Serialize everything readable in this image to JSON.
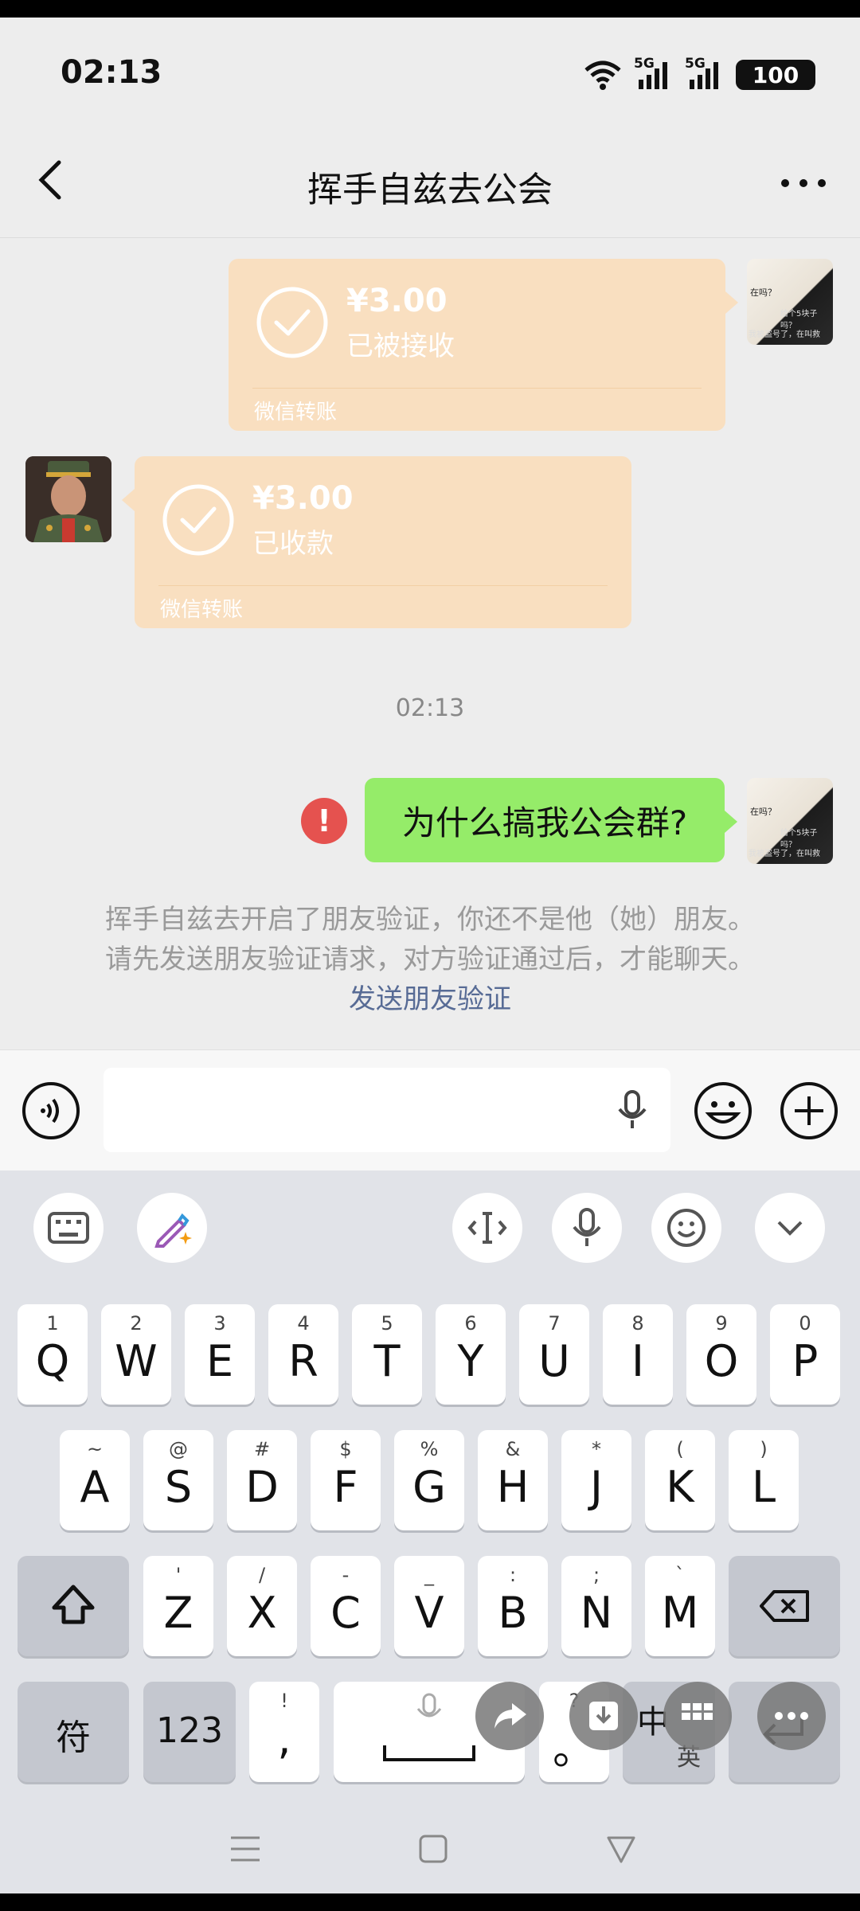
{
  "status_bar": {
    "time": "02:13",
    "signal1": "5G",
    "signal2": "5G",
    "battery": "100"
  },
  "header": {
    "title": "挥手自兹去公会"
  },
  "messages": {
    "transfer_sent": {
      "amount": "¥3.00",
      "status": "已被接收",
      "label": "微信转账"
    },
    "transfer_received": {
      "amount": "¥3.00",
      "status": "已收款",
      "label": "微信转账"
    },
    "timestamp": "02:13",
    "text_message": "为什么搞我公会群?",
    "error_mark": "!",
    "system_notice": {
      "line1": "挥手自兹去开启了朋友验证，你还不是他（她）朋友。",
      "line2": "请先发送朋友验证请求，对方验证通过后，才能聊天。",
      "link": "发送朋友验证"
    }
  },
  "avatar_me_text": {
    "t1": "在吗？",
    "t2": "给个5块子吗？",
    "t3": "我被盗号了，在叫救"
  },
  "keyboard": {
    "row1": [
      {
        "main": "Q",
        "sub": "1"
      },
      {
        "main": "W",
        "sub": "2"
      },
      {
        "main": "E",
        "sub": "3"
      },
      {
        "main": "R",
        "sub": "4"
      },
      {
        "main": "T",
        "sub": "5"
      },
      {
        "main": "Y",
        "sub": "6"
      },
      {
        "main": "U",
        "sub": "7"
      },
      {
        "main": "I",
        "sub": "8"
      },
      {
        "main": "O",
        "sub": "9"
      },
      {
        "main": "P",
        "sub": "0"
      }
    ],
    "row2": [
      {
        "main": "A",
        "sub": "~"
      },
      {
        "main": "S",
        "sub": "@"
      },
      {
        "main": "D",
        "sub": "#"
      },
      {
        "main": "F",
        "sub": "$"
      },
      {
        "main": "G",
        "sub": "%"
      },
      {
        "main": "H",
        "sub": "&"
      },
      {
        "main": "J",
        "sub": "*"
      },
      {
        "main": "K",
        "sub": "("
      },
      {
        "main": "L",
        "sub": ")"
      }
    ],
    "row3": [
      {
        "main": "Z",
        "sub": "'"
      },
      {
        "main": "X",
        "sub": "/"
      },
      {
        "main": "C",
        "sub": "-"
      },
      {
        "main": "V",
        "sub": "_"
      },
      {
        "main": "B",
        "sub": ":"
      },
      {
        "main": "N",
        "sub": ";"
      },
      {
        "main": "M",
        "sub": "`"
      }
    ],
    "symbol_key": "符",
    "number_key": "123",
    "comma_key": {
      "main": ",",
      "sub": "!"
    },
    "period_key": {
      "main": "。",
      "sub": "?"
    },
    "lang_key": "中",
    "lang_sub": "英"
  },
  "icons": {
    "back": "chevron-left-icon",
    "more": "more-dots-icon",
    "voice": "voice-icon",
    "mic": "mic-icon",
    "emoji": "emoji-icon",
    "plus": "plus-icon",
    "check": "check-circle-icon"
  },
  "colors": {
    "transfer_bg": "#f9dfc0",
    "bubble_green": "#95ec69",
    "link": "#576b95",
    "error": "#e5524f"
  }
}
